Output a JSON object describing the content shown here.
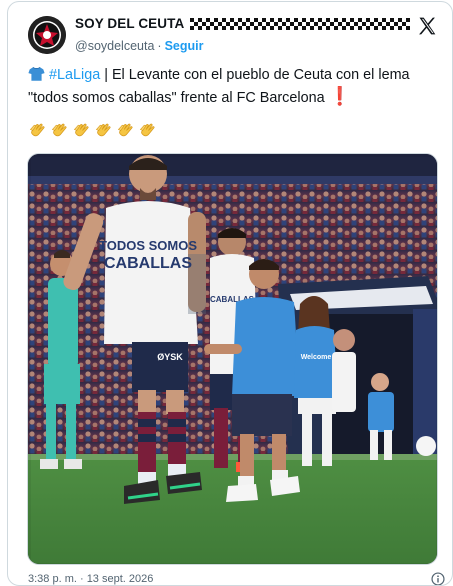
{
  "author": {
    "display_name": "SOY DEL CEUTA",
    "handle": "@soydelceuta",
    "separator": "·",
    "follow_label": "Seguir"
  },
  "tweet": {
    "hashtag": "#LaLiga",
    "text_after_hashtag": " | El Levante con el pueblo de Ceuta con el lema \"todos somos caballas\" frente al FC Barcelona",
    "emoji_line_count": 6
  },
  "photo": {
    "shirt_text_line1": "TODOS SOMOS",
    "shirt_text_line2": "CABALLAS",
    "sponsor_text": "ØYSK",
    "kid_shirt_text": "Welcome"
  },
  "footer": {
    "timestamp": "3:38 p. m. · 13 sept. 2026"
  },
  "colors": {
    "link_blue": "#1d9bf0",
    "muted_grey": "#536471",
    "exclamation_red": "#e0245e"
  },
  "icons": [
    "avatar-logo",
    "checkered-flag-icon",
    "x-logo-icon",
    "tshirt-icon",
    "exclamation-icon",
    "clapping-hands-icon",
    "info-icon"
  ]
}
